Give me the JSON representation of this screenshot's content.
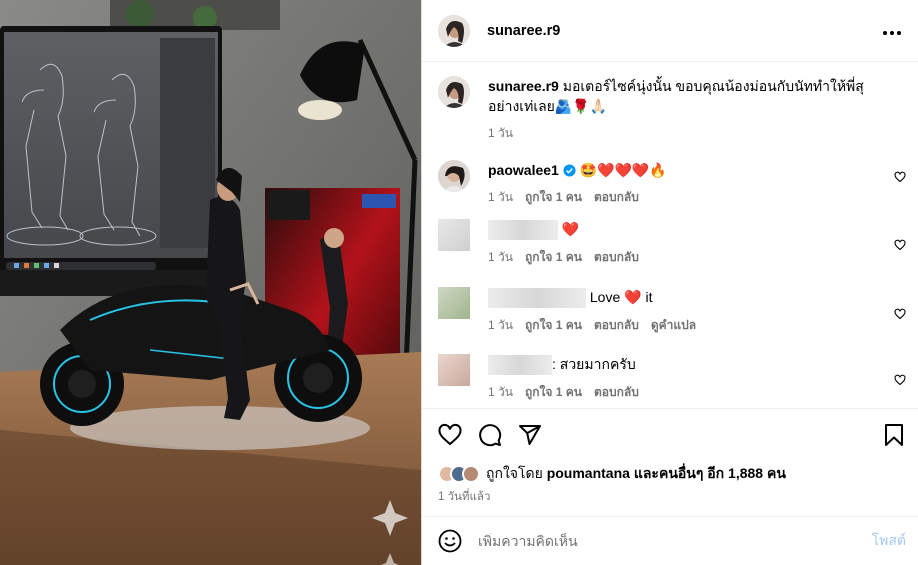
{
  "post": {
    "author": "sunaree.r9",
    "more_icon": "more-horizontal-icon"
  },
  "caption": {
    "username": "sunaree.r9",
    "text": "มอเตอร์ไซค์นุ่งนั้น ขอบคุณน้องม่อนกับนัททำให้พี่สุอย่างเท่เลย🫂🌹🙏🏻",
    "time": "1 วัน"
  },
  "comments": [
    {
      "username": "paowalee1",
      "verified": true,
      "text": "🤩❤️❤️❤️🔥",
      "time": "1 วัน",
      "likes": "ถูกใจ 1 คน",
      "reply": "ตอบกลับ",
      "translate": ""
    },
    {
      "username": "",
      "text": "❤️",
      "time": "1 วัน",
      "likes": "ถูกใจ 1 คน",
      "reply": "ตอบกลับ",
      "translate": ""
    },
    {
      "username": "",
      "text": "Love ❤️ it",
      "time": "1 วัน",
      "likes": "ถูกใจ 1 คน",
      "reply": "ตอบกลับ",
      "translate": "ดูคำแปล"
    },
    {
      "username": "",
      "text": ": สวยมากครับ",
      "time": "1 วัน",
      "likes": "ถูกใจ 1 คน",
      "reply": "ตอบกลับ",
      "translate": ""
    }
  ],
  "likes_line": {
    "prefix": "ถูกใจโดย",
    "name": "poumantana",
    "suffix": "และคนอื่นๆ อีก 1,888 คน"
  },
  "posted": "1 วันที่แล้ว",
  "composer": {
    "placeholder": "เพิ่มความคิดเห็น",
    "post_label": "โพสต์"
  },
  "colors": {
    "verified": "#0095f6",
    "like_red": "#ff3040",
    "post_disabled": "#a5c8f6"
  }
}
